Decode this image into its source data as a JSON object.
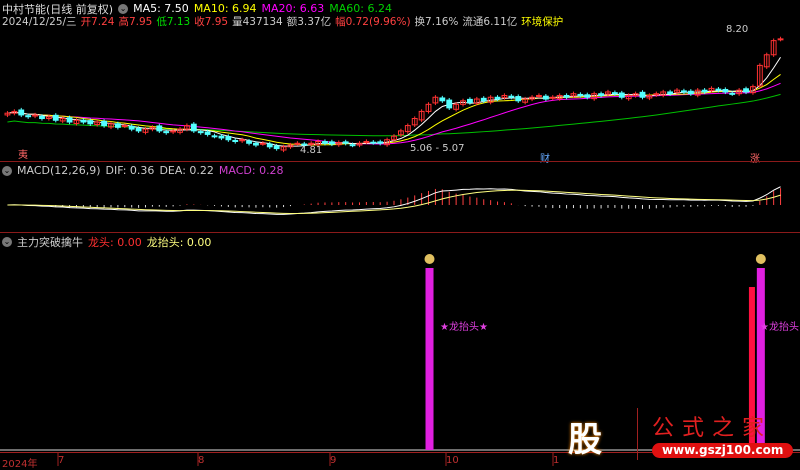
{
  "header": {
    "title": "中村节能(日线 前复权)",
    "ma5": "MA5: 7.50",
    "ma10": "MA10: 6.94",
    "ma20": "MA20: 6.63",
    "ma60": "MA60: 6.24",
    "date": "2024/12/25/三",
    "open": "开7.24",
    "high": "高7.95",
    "low": "低7.13",
    "close": "收7.95",
    "vol": "量437134",
    "amount": "额3.37亿",
    "change": "幅0.72(9.96%)",
    "turnover": "换7.16%",
    "float": "流通6.11亿",
    "tag": "环境保护"
  },
  "price_chart": {
    "high_label": "8.20",
    "low_label": "4.81",
    "range_label": "5.06 - 5.07",
    "marker_cai": "财",
    "marker_zhang": "涨",
    "marker_left": "夷",
    "closes": [
      5.85,
      5.9,
      5.8,
      5.75,
      5.8,
      5.7,
      5.75,
      5.65,
      5.7,
      5.6,
      5.65,
      5.6,
      5.55,
      5.6,
      5.5,
      5.55,
      5.45,
      5.5,
      5.4,
      5.35,
      5.4,
      5.45,
      5.35,
      5.3,
      5.35,
      5.4,
      5.5,
      5.35,
      5.3,
      5.25,
      5.2,
      5.15,
      5.1,
      5.05,
      5.1,
      5.0,
      4.95,
      5.0,
      4.9,
      4.85,
      4.9,
      4.95,
      5.0,
      4.95,
      5.0,
      5.05,
      5.0,
      4.98,
      5.02,
      5.0,
      4.95,
      5.0,
      5.05,
      5.02,
      5.0,
      5.1,
      5.2,
      5.35,
      5.5,
      5.7,
      5.9,
      6.1,
      6.3,
      6.2,
      6.0,
      6.1,
      6.2,
      6.15,
      6.25,
      6.2,
      6.3,
      6.25,
      6.35,
      6.3,
      6.2,
      6.25,
      6.3,
      6.35,
      6.25,
      6.3,
      6.35,
      6.3,
      6.4,
      6.35,
      6.3,
      6.4,
      6.35,
      6.45,
      6.4,
      6.3,
      6.35,
      6.4,
      6.3,
      6.35,
      6.4,
      6.45,
      6.4,
      6.5,
      6.45,
      6.4,
      6.5,
      6.45,
      6.55,
      6.5,
      6.45,
      6.4,
      6.5,
      6.45,
      6.6,
      7.2,
      7.5,
      7.9,
      7.95
    ],
    "ylim": [
      4.81,
      8.2
    ]
  },
  "macd": {
    "title": "MACD(12,26,9)",
    "dif": "DIF: 0.36",
    "dea": "DEA: 0.22",
    "macd": "MACD: 0.28"
  },
  "indicator": {
    "title": "主力突破擒牛",
    "longtou": "龙头: 0.00",
    "longtaitou": "龙抬头: 0.00",
    "signal_label": "★龙抬头★",
    "signal_indices": [
      61,
      109
    ],
    "red_indices": [
      108
    ]
  },
  "axis": {
    "labels": [
      "2024年",
      "7",
      "8",
      "9",
      "10",
      "1"
    ]
  },
  "logo": {
    "char": "股",
    "name": "公式之家",
    "url": "www.gszj100.com"
  },
  "colors": {
    "up": "#ff3232",
    "down": "#54ffff",
    "ma5": "#ffffff",
    "ma10": "#ffff00",
    "ma20": "#ff00ff",
    "ma60": "#00c000"
  }
}
